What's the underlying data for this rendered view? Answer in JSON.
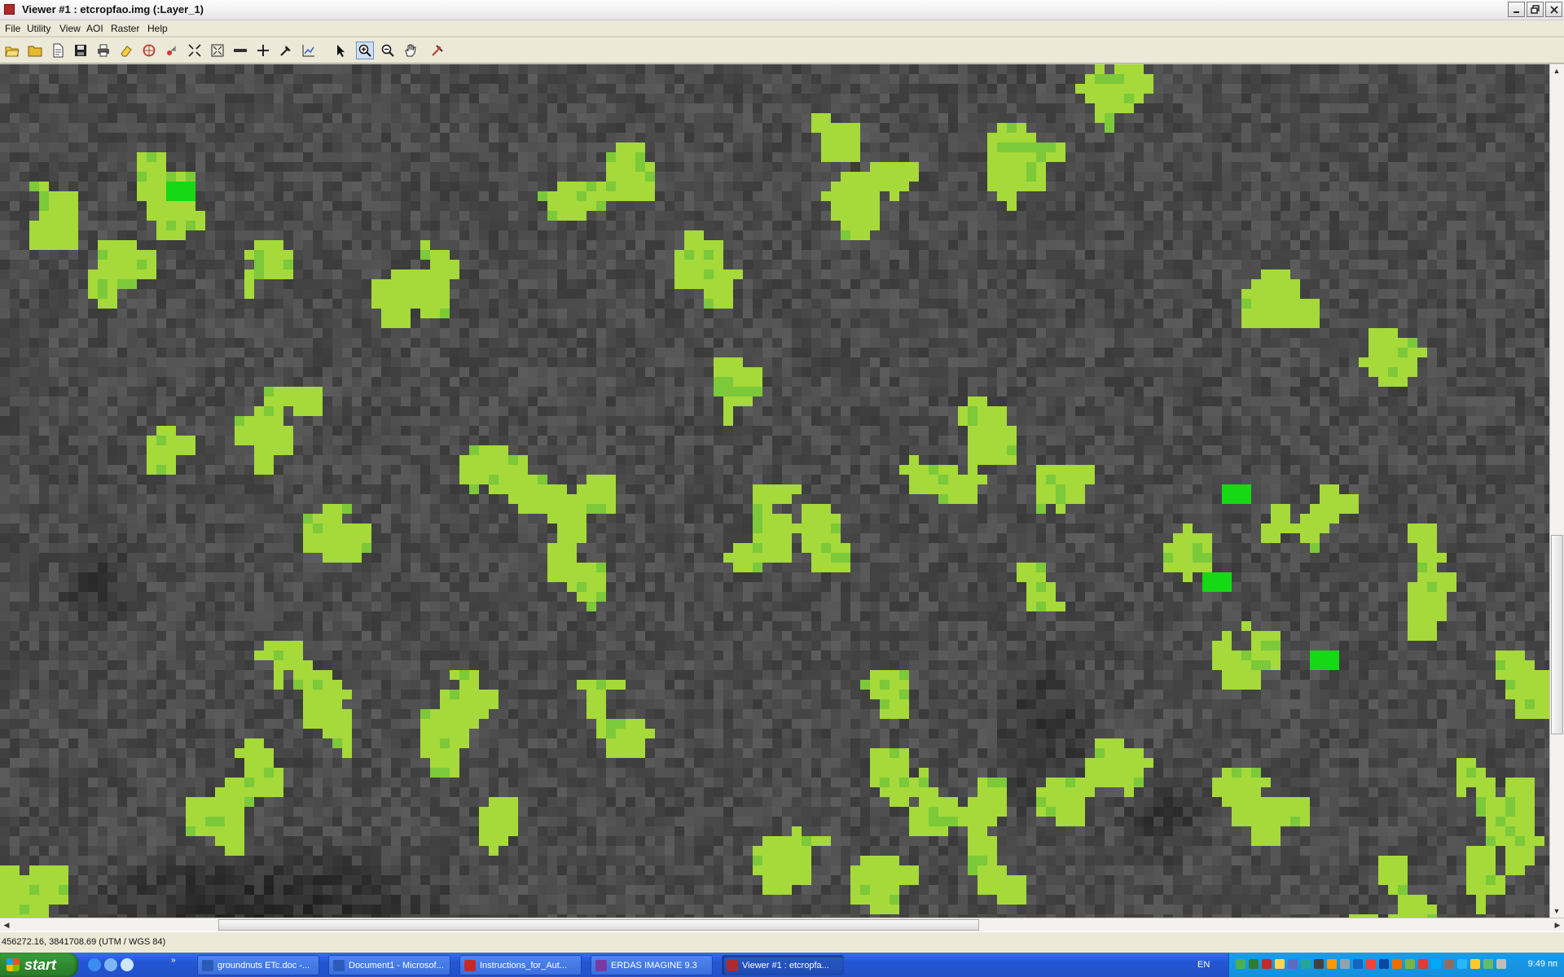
{
  "window": {
    "title": "Viewer #1 : etcropfao.img (:Layer_1)",
    "controls": [
      "minimize",
      "maximize",
      "close"
    ]
  },
  "menu": {
    "items": [
      "File",
      "Utility",
      "View",
      "AOI",
      "Raster",
      "Help"
    ]
  },
  "toolbar": {
    "tools": [
      {
        "icon": "open-folder-icon"
      },
      {
        "icon": "folder-icon"
      },
      {
        "icon": "document-icon"
      },
      {
        "icon": "save-icon"
      },
      {
        "icon": "print-icon"
      },
      {
        "icon": "eraser-icon"
      },
      {
        "icon": "globe-icon"
      },
      {
        "icon": "clear-icon"
      },
      {
        "icon": "zoom-extent-icon"
      },
      {
        "icon": "fit-window-icon"
      },
      {
        "icon": "measure-icon"
      },
      {
        "icon": "crosshair-icon"
      },
      {
        "icon": "inquire-icon"
      },
      {
        "icon": "profile-icon"
      },
      {
        "icon": "select-arrow-icon"
      },
      {
        "icon": "zoom-in-icon",
        "active": true
      },
      {
        "icon": "zoom-out-icon"
      },
      {
        "icon": "pan-hand-icon"
      },
      {
        "icon": "link-icon"
      }
    ]
  },
  "image": {
    "description_colors": {
      "background": "#4a4a4a",
      "crop": "#a6d93a",
      "crop_dark": "#7cc93a",
      "high": "#16d916",
      "highest": "#0b6b0b"
    }
  },
  "status": {
    "coordinates": "456272.16, 3841708.69  (UTM / WGS 84)"
  },
  "taskbar": {
    "start_label": "start",
    "tasks": [
      {
        "label": "groundnuts ETc.doc -...",
        "active": false,
        "color": "#2b5bb8"
      },
      {
        "label": "Document1 - Microsof...",
        "active": false,
        "color": "#2b5bb8"
      },
      {
        "label": "Instructions_for_Aut...",
        "active": false,
        "color": "#c62828"
      },
      {
        "label": "ERDAS IMAGINE 9.3",
        "active": false,
        "color": "#7a3aa0"
      },
      {
        "label": "Viewer #1 : etcropfa...",
        "active": true,
        "color": "#b02a2a"
      }
    ],
    "language": "EN",
    "clock": "9:49 пп"
  }
}
